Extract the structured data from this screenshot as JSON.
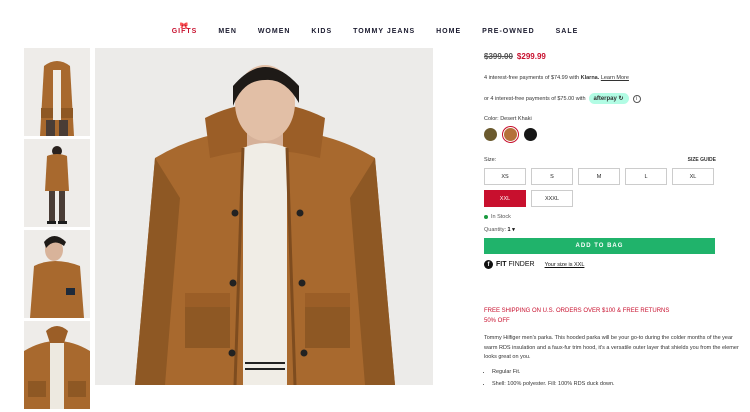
{
  "nav": {
    "items": [
      "GIFTS",
      "MEN",
      "WOMEN",
      "KIDS",
      "TOMMY JEANS",
      "HOME",
      "PRE-OWNED",
      "SALE"
    ]
  },
  "product": {
    "original_price": "$399.00",
    "sale_price": "$299.99",
    "klarna_text": "4 interest-free payments of $74.99 with",
    "klarna_brand": "Klarna.",
    "klarna_link": "Learn More",
    "afterpay_text": "or 4 interest-free payments of $75.00 with",
    "afterpay_brand": "afterpay",
    "color_label": "Color: Desert Khaki",
    "swatches": [
      {
        "name": "olive",
        "color": "#6b5a2e"
      },
      {
        "name": "desert-khaki",
        "color": "#b5713a"
      },
      {
        "name": "black",
        "color": "#161616"
      }
    ],
    "size_label": "Size:",
    "size_guide": "SIZE GUIDE",
    "sizes": [
      "XS",
      "S",
      "M",
      "L",
      "XL",
      "XXL",
      "XXXL"
    ],
    "selected_size": "XXL",
    "stock": "In Stock",
    "quantity_label": "Quantity:",
    "quantity_value": "1",
    "add_to_bag": "ADD TO BAG",
    "fit_finder_bold": "FIT",
    "fit_finder_rest": "FINDER",
    "your_size": "Your size is XXL",
    "promo_line1": "FREE SHIPPING ON U.S. ORDERS OVER $100 & FREE RETURNS",
    "promo_line2": "50% OFF",
    "description_lines": [
      "Tommy Hilfiger men's parka. This hooded parka will be your go-to during the colder months of the year",
      "warm RDS insulation and a faux-fur trim hood, it's a versatile outer layer that shields you from the elemer",
      "looks great on you."
    ],
    "bullets": [
      "Regular Fit.",
      "Shell: 100% polyester. Fill: 100% RDS duck down."
    ]
  },
  "colors": {
    "accent": "#c8102e",
    "add_button": "#20b36b",
    "jacket": "#a8692e"
  }
}
